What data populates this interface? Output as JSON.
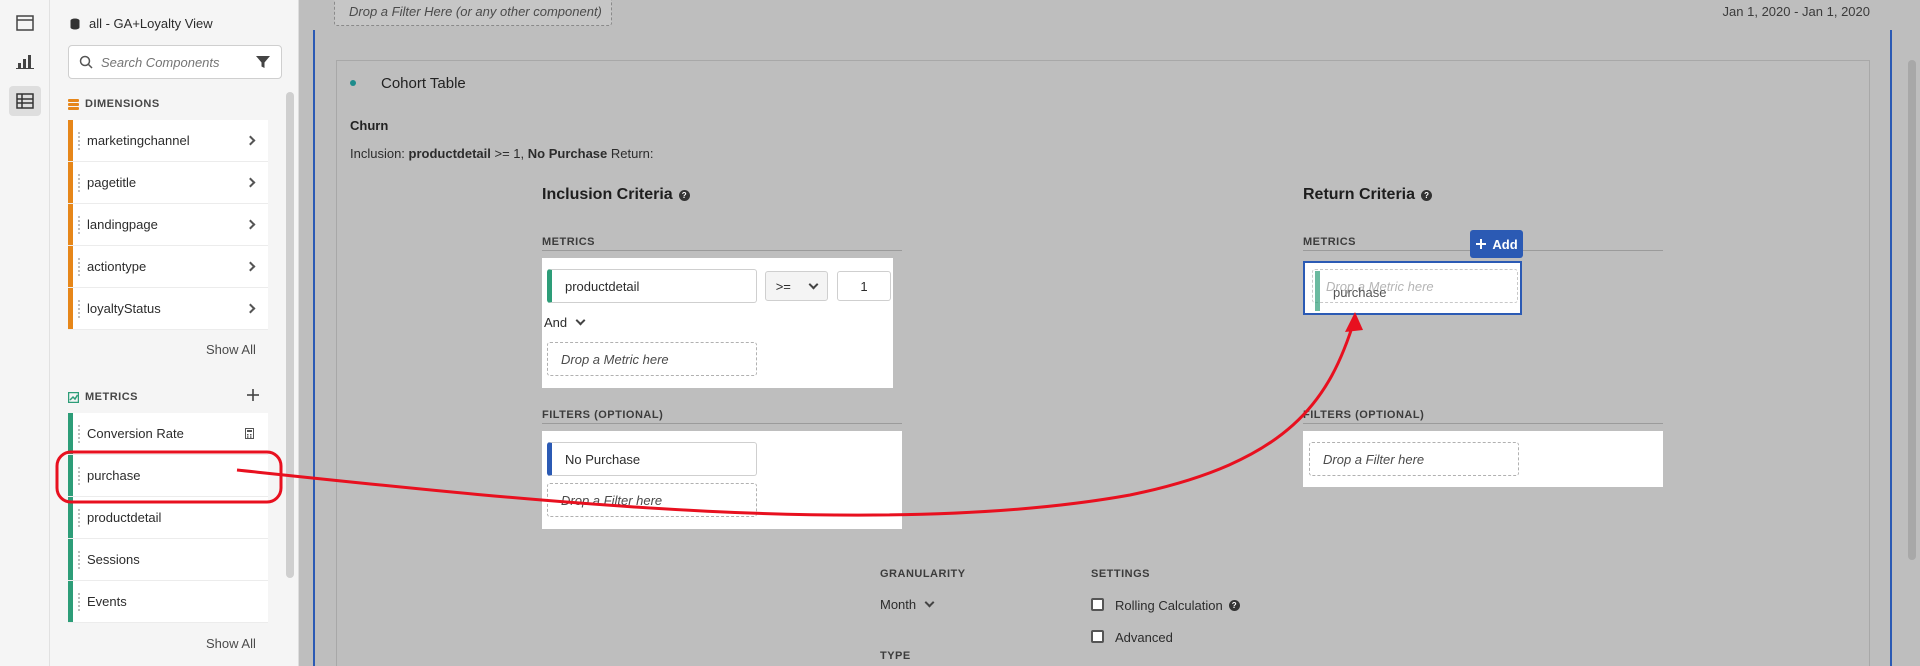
{
  "rail": {
    "icons": [
      "panel-icon",
      "visualizations-icon",
      "components-icon"
    ]
  },
  "components": {
    "report_suite": "all - GA+Loyalty View",
    "search_placeholder": "Search Components",
    "dimensions_header": "DIMENSIONS",
    "dimensions": [
      "marketingchannel",
      "pagetitle",
      "landingpage",
      "actiontype",
      "loyaltyStatus"
    ],
    "dimensions_show_all": "Show All",
    "metrics_header": "METRICS",
    "metrics": [
      "Conversion Rate",
      "purchase",
      "productdetail",
      "Sessions",
      "Events"
    ],
    "metrics_show_all": "Show All"
  },
  "canvas": {
    "drop_filter_top": "Drop a Filter Here (or any other component)",
    "date_range": "Jan 1, 2020 - Jan 1, 2020",
    "panel_title": "Cohort Table",
    "table_name": "Churn",
    "summary": {
      "prefix": "Inclusion:",
      "metric": "productdetail",
      "condition": ">= 1,",
      "filter": "No Purchase",
      "return": "Return:"
    }
  },
  "inclusion": {
    "title": "Inclusion Criteria",
    "metrics_caption": "METRICS",
    "metric": "productdetail",
    "operator": ">=",
    "value": "1",
    "conjunction": "And",
    "drop_metric": "Drop a Metric here",
    "filters_caption": "FILTERS (OPTIONAL)",
    "filter": "No Purchase",
    "drop_filter": "Drop a Filter here"
  },
  "return": {
    "title": "Return Criteria",
    "metrics_caption": "METRICS",
    "add_label": "Add",
    "drop_metric": "Drop a Metric here",
    "dragging": "purchase",
    "filters_caption": "FILTERS (OPTIONAL)",
    "drop_filter": "Drop a Filter here"
  },
  "settings": {
    "granularity_caption": "GRANULARITY",
    "granularity": "Month",
    "type_caption": "TYPE",
    "settings_caption": "SETTINGS",
    "rolling": "Rolling Calculation",
    "advanced": "Advanced"
  },
  "colors": {
    "accent": "#2b5ab4",
    "dimension": "#e68619",
    "metric": "#2d9d78",
    "annotation": "#e8101f"
  }
}
